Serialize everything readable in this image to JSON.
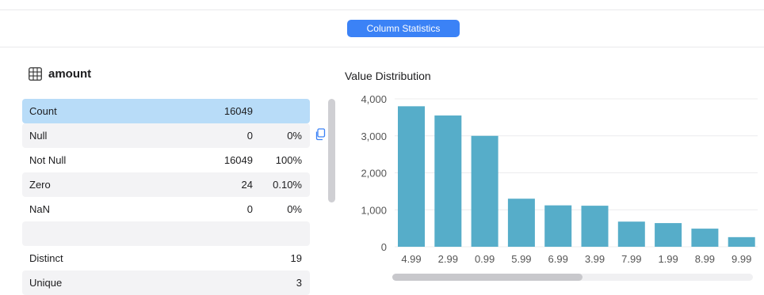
{
  "header": {
    "tab_label": "Column Statistics"
  },
  "column": {
    "name": "amount"
  },
  "stats": {
    "rows": [
      {
        "label": "Count",
        "count": "16049",
        "pct": ""
      },
      {
        "label": "Null",
        "count": "0",
        "pct": "0%"
      },
      {
        "label": "Not Null",
        "count": "16049",
        "pct": "100%"
      },
      {
        "label": "Zero",
        "count": "24",
        "pct": "0.10%"
      },
      {
        "label": "NaN",
        "count": "0",
        "pct": "0%"
      },
      {
        "label": "",
        "count": "",
        "pct": ""
      },
      {
        "label": "Distinct",
        "count": "",
        "pct": "19"
      },
      {
        "label": "Unique",
        "count": "",
        "pct": "3"
      }
    ]
  },
  "chart_title": "Value Distribution",
  "chart_data": {
    "type": "bar",
    "title": "Value Distribution",
    "categories": [
      "4.99",
      "2.99",
      "0.99",
      "5.99",
      "6.99",
      "3.99",
      "7.99",
      "1.99",
      "8.99",
      "9.99"
    ],
    "values": [
      3800,
      3550,
      3000,
      1300,
      1120,
      1110,
      680,
      640,
      490,
      260
    ],
    "yticks": [
      "4,000",
      "3,000",
      "2,000",
      "1,000",
      "0"
    ],
    "ylim": [
      0,
      4000
    ],
    "grid": true,
    "bar_color": "#56adc9"
  },
  "colors": {
    "accent": "#3b82f6",
    "selected_row": "#b8dcf8",
    "bar": "#56adc9"
  }
}
